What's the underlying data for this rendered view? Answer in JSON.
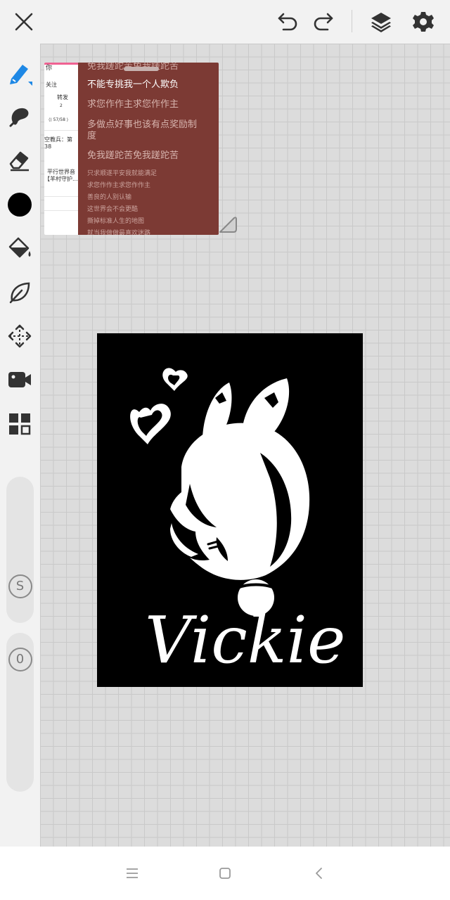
{
  "toolbar": {
    "close_icon": "close-icon",
    "undo_icon": "undo-icon",
    "redo_icon": "redo-icon",
    "layers_icon": "layers-icon",
    "settings_icon": "gear-icon"
  },
  "tools": [
    {
      "name": "brush",
      "icon": "pen-icon",
      "active": true
    },
    {
      "name": "smudge",
      "icon": "smudge-icon"
    },
    {
      "name": "eraser",
      "icon": "eraser-icon"
    },
    {
      "name": "color",
      "icon": "color-swatch",
      "color": "#000000"
    },
    {
      "name": "fill",
      "icon": "fill-bucket-icon"
    },
    {
      "name": "lasso",
      "icon": "lasso-leaf-icon"
    },
    {
      "name": "transform",
      "icon": "move-icon"
    },
    {
      "name": "record",
      "icon": "video-icon"
    },
    {
      "name": "gallery",
      "icon": "grid-icon"
    }
  ],
  "sliders": {
    "size_label": "S",
    "opacity_label": "0"
  },
  "reference": {
    "left_lines": [
      "你",
      "关注",
      "转发",
      "2",
      "⟨⟩ 57/58 ⟩",
      "空教兵：第38",
      "平行世界音",
      "【羊村守护..."
    ],
    "lines": [
      "免我蹉跎苦免我蹉跎苦",
      "不能专挑我一个人欺负",
      "求您作作主求您作作主",
      "多做点好事也该有点奖励制",
      "度",
      "免我蹉跎苦免我蹉跎苦",
      "只求顺遂平安我就能满足",
      "求您作作主求您作作主",
      "善良的人别认输",
      "这世界会不会更酷",
      "撕掉标准人生的地图",
      "就当我做做最喜欢迷路"
    ]
  },
  "artwork": {
    "signature": "Vickie",
    "background": "#000000",
    "ink": "#ffffff"
  },
  "navbar": {
    "menu_icon": "menu-icon",
    "home_icon": "home-square-icon",
    "back_icon": "back-chevron-icon"
  }
}
